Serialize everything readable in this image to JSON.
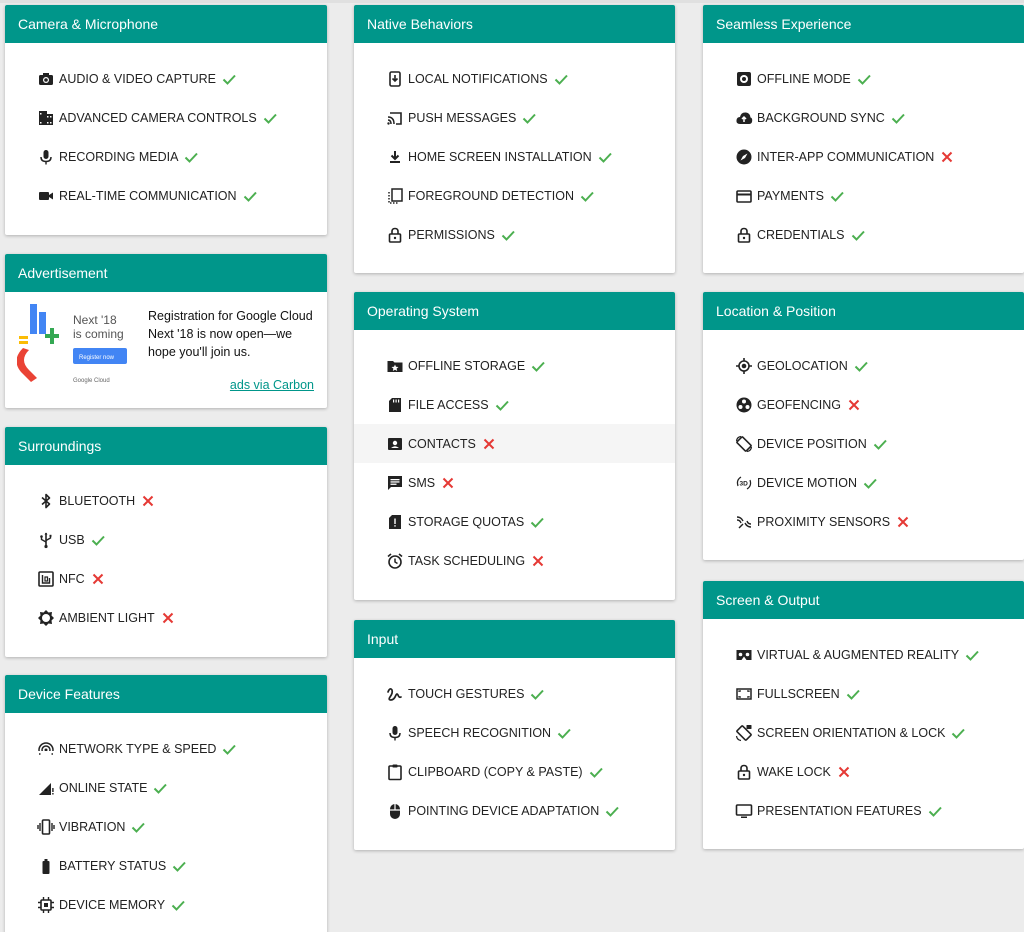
{
  "colors": {
    "header": "#00968a",
    "check": "#4caf50",
    "cross": "#e53935"
  },
  "cards": {
    "camera": {
      "title": "Camera & Microphone",
      "items": [
        {
          "label": "AUDIO & VIDEO CAPTURE",
          "icon": "camera-icon",
          "status": "yes"
        },
        {
          "label": "ADVANCED CAMERA CONTROLS",
          "icon": "camera-roll-icon",
          "status": "yes"
        },
        {
          "label": "RECORDING MEDIA",
          "icon": "microphone-icon",
          "status": "yes"
        },
        {
          "label": "REAL-TIME COMMUNICATION",
          "icon": "videocam-icon",
          "status": "yes"
        }
      ]
    },
    "native": {
      "title": "Native Behaviors",
      "items": [
        {
          "label": "LOCAL NOTIFICATIONS",
          "icon": "notification-icon",
          "status": "yes"
        },
        {
          "label": "PUSH MESSAGES",
          "icon": "cast-icon",
          "status": "yes"
        },
        {
          "label": "HOME SCREEN INSTALLATION",
          "icon": "download-icon",
          "status": "yes"
        },
        {
          "label": "FOREGROUND DETECTION",
          "icon": "foreground-icon",
          "status": "yes"
        },
        {
          "label": "PERMISSIONS",
          "icon": "lock-open-icon",
          "status": "yes"
        }
      ]
    },
    "seamless": {
      "title": "Seamless Experience",
      "items": [
        {
          "label": "OFFLINE MODE",
          "icon": "offline-icon",
          "status": "yes"
        },
        {
          "label": "BACKGROUND SYNC",
          "icon": "cloud-upload-icon",
          "status": "yes"
        },
        {
          "label": "INTER-APP COMMUNICATION",
          "icon": "compass-icon",
          "status": "no"
        },
        {
          "label": "PAYMENTS",
          "icon": "credit-card-icon",
          "status": "yes"
        },
        {
          "label": "CREDENTIALS",
          "icon": "lock-icon",
          "status": "yes"
        }
      ]
    },
    "advertisement": {
      "title": "Advertisement",
      "text": "Registration for Google Cloud Next '18 is now open—we hope you'll join us.",
      "link": "ads via Carbon",
      "image_line1": "Next '18",
      "image_line2": "is coming",
      "image_button": "Register now",
      "image_brand": "Google Cloud"
    },
    "os": {
      "title": "Operating System",
      "items": [
        {
          "label": "OFFLINE STORAGE",
          "icon": "folder-star-icon",
          "status": "yes"
        },
        {
          "label": "FILE ACCESS",
          "icon": "sd-card-icon",
          "status": "yes"
        },
        {
          "label": "CONTACTS",
          "icon": "contact-icon",
          "status": "no"
        },
        {
          "label": "SMS",
          "icon": "message-icon",
          "status": "no"
        },
        {
          "label": "STORAGE QUOTAS",
          "icon": "storage-alert-icon",
          "status": "yes"
        },
        {
          "label": "TASK SCHEDULING",
          "icon": "alarm-icon",
          "status": "no"
        }
      ]
    },
    "location": {
      "title": "Location & Position",
      "items": [
        {
          "label": "GEOLOCATION",
          "icon": "gps-icon",
          "status": "yes"
        },
        {
          "label": "GEOFENCING",
          "icon": "geofence-icon",
          "status": "no"
        },
        {
          "label": "DEVICE POSITION",
          "icon": "screen-rotation-icon",
          "status": "yes"
        },
        {
          "label": "DEVICE MOTION",
          "icon": "3d-rotation-icon",
          "status": "yes"
        },
        {
          "label": "PROXIMITY SENSORS",
          "icon": "proximity-icon",
          "status": "no"
        }
      ]
    },
    "surroundings": {
      "title": "Surroundings",
      "items": [
        {
          "label": "BLUETOOTH",
          "icon": "bluetooth-icon",
          "status": "no"
        },
        {
          "label": "USB",
          "icon": "usb-icon",
          "status": "yes"
        },
        {
          "label": "NFC",
          "icon": "nfc-icon",
          "status": "no"
        },
        {
          "label": "AMBIENT LIGHT",
          "icon": "brightness-icon",
          "status": "no"
        }
      ]
    },
    "input": {
      "title": "Input",
      "items": [
        {
          "label": "TOUCH GESTURES",
          "icon": "gesture-icon",
          "status": "yes"
        },
        {
          "label": "SPEECH RECOGNITION",
          "icon": "microphone-icon",
          "status": "yes"
        },
        {
          "label": "CLIPBOARD (COPY & PASTE)",
          "icon": "clipboard-icon",
          "status": "yes"
        },
        {
          "label": "POINTING DEVICE ADAPTATION",
          "icon": "mouse-icon",
          "status": "yes"
        }
      ]
    },
    "screen": {
      "title": "Screen & Output",
      "items": [
        {
          "label": "VIRTUAL & AUGMENTED REALITY",
          "icon": "vr-icon",
          "status": "yes"
        },
        {
          "label": "FULLSCREEN",
          "icon": "fullscreen-icon",
          "status": "yes"
        },
        {
          "label": "SCREEN ORIENTATION & LOCK",
          "icon": "screen-lock-rotation-icon",
          "status": "yes"
        },
        {
          "label": "WAKE LOCK",
          "icon": "lock-icon",
          "status": "no"
        },
        {
          "label": "PRESENTATION FEATURES",
          "icon": "monitor-icon",
          "status": "yes"
        }
      ]
    },
    "device": {
      "title": "Device Features",
      "items": [
        {
          "label": "NETWORK TYPE & SPEED",
          "icon": "network-icon",
          "status": "yes"
        },
        {
          "label": "ONLINE STATE",
          "icon": "signal-icon",
          "status": "yes"
        },
        {
          "label": "VIBRATION",
          "icon": "vibration-icon",
          "status": "yes"
        },
        {
          "label": "BATTERY STATUS",
          "icon": "battery-icon",
          "status": "yes"
        },
        {
          "label": "DEVICE MEMORY",
          "icon": "memory-icon",
          "status": "yes"
        }
      ]
    }
  }
}
